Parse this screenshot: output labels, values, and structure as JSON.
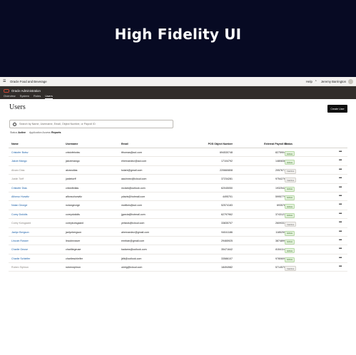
{
  "hero": {
    "title": "High Fidelity UI"
  },
  "topbar": {
    "menu_icon": "hamburger-icon",
    "app_title": "Oracle Food and Beverage",
    "help_label": "Help",
    "user_name": "Jeremy Barrington"
  },
  "header": {
    "app_name": "Oracle Administration",
    "nav": [
      "Overview",
      "System",
      "Roles",
      "Users"
    ],
    "active_nav": "Users"
  },
  "page": {
    "title": "Users",
    "create_button": "Create User",
    "search_placeholder": "Search by Name, Username, Email, Object Number, or Payroll ID"
  },
  "filters": {
    "status_label": "Status",
    "status_value": "Active",
    "application_access_label": "Application Access",
    "reports_label": "Reports"
  },
  "table": {
    "columns": [
      "Name",
      "Username",
      "Email",
      "POS Object Number",
      "External Payroll ID",
      "Status"
    ],
    "rows": [
      {
        "name": "Cristofer Botsv",
        "username": "cristofebotsv",
        "email": "tthomas@aol.com",
        "pos": "694530748",
        "payroll": "82759048",
        "status": "Active"
      },
      {
        "name": "Jakob Mango",
        "username": "jakobmango",
        "email": "ehernandez@aol.com",
        "pos": "17104792",
        "payroll": "14808361",
        "status": "Active"
      },
      {
        "name": "Alvaro Dias",
        "username": "alvarodias",
        "email": "kclark@gmail.com",
        "pos": "220660808",
        "payroll": "20576779",
        "status": "Inactive"
      },
      {
        "name": "Justin Torff",
        "username": "justintorff",
        "email": "aauinnez@icloud.com",
        "pos": "37234281",
        "payroll": "97542767",
        "status": "Inactive"
      },
      {
        "name": "Cristofer Dias",
        "username": "cristofedias",
        "email": "mclark@outlook.com",
        "pos": "62045050",
        "payroll": "19325427",
        "status": "Active"
      },
      {
        "name": "Alfonso Hurwitz",
        "username": "alfonsohorwitz",
        "email": "ydavis@hotmail.com",
        "pos": "4495701",
        "payroll": "59957792",
        "status": "Active"
      },
      {
        "name": "Nolan George",
        "username": "nolangeorge",
        "email": "mwilkes@aol.com",
        "pos": "52574183",
        "payroll": "6935763",
        "status": "Active"
      },
      {
        "name": "Corey Dokidis",
        "username": "coreydokidis",
        "email": "jgarcia@hotmail.com",
        "pos": "62797962",
        "payroll": "37431239",
        "status": "Active"
      },
      {
        "name": "Corey Korsgaard",
        "username": "coreykorsgaard",
        "email": "yelswis@icloud.com",
        "pos": "33835707",
        "payroll": "26093372",
        "status": "Inactive"
      },
      {
        "name": "Jaxlyn Bergson",
        "username": "jaxlynbergson",
        "email": "ahernandez@gmail.com",
        "pos": "94041186",
        "payroll": "11852599",
        "status": "Active"
      },
      {
        "name": "Lincoln Rosser",
        "username": "lincolnrosser",
        "email": "emrban@gmail.com",
        "pos": "29465925",
        "payroll": "38748991",
        "status": "Active"
      },
      {
        "name": "Charlie Geuse",
        "username": "charlitegeuse",
        "email": "kadams@outlook.com",
        "pos": "35471642",
        "payroll": "81541140",
        "status": "Active"
      },
      {
        "name": "Charlie Schleifer",
        "username": "charlieschleifer",
        "email": "jkfk@outlook.com",
        "pos": "33586107",
        "payroll": "97806099",
        "status": "Active"
      },
      {
        "name": "Ruben Siphron",
        "username": "rubensiphron",
        "email": "ukirig@icloud.com",
        "pos": "18494982",
        "payroll": "57145707",
        "status": "Inactive"
      }
    ],
    "more_icon": "more-horizontal-icon"
  },
  "colors": {
    "link": "#1a5ea5",
    "header_bg": "#312d2a",
    "accent": "#c74634",
    "page_bg": "#070a23"
  }
}
